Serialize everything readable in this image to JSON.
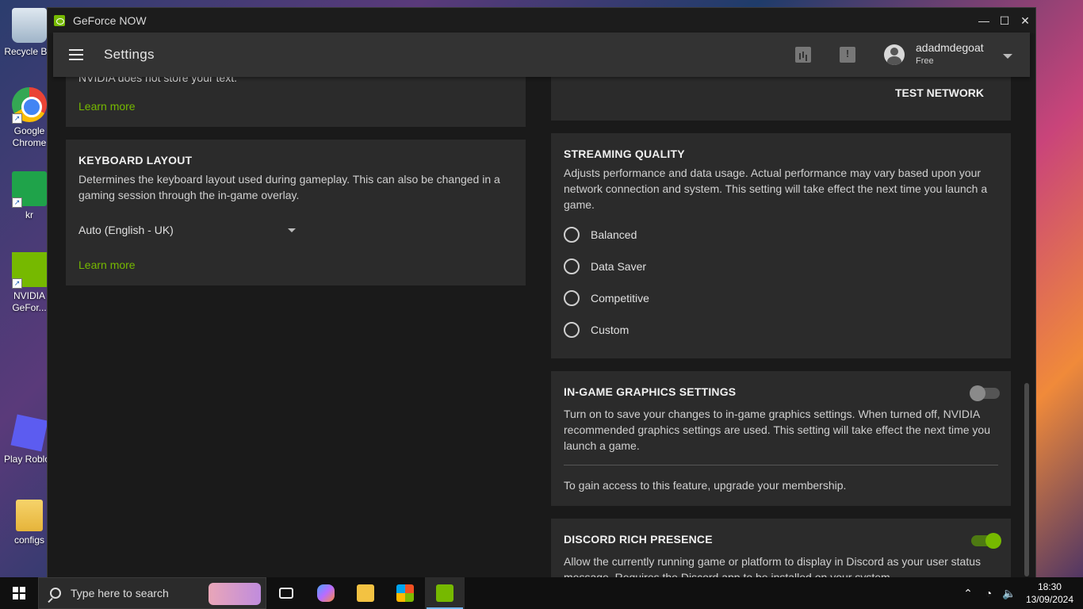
{
  "desktop": {
    "icons": [
      {
        "label": "Recycle Bin"
      },
      {
        "label": "Google Chrome"
      },
      {
        "label": "kr"
      },
      {
        "label": "NVIDIA GeFor..."
      },
      {
        "label": "Play Roblox"
      },
      {
        "label": "configs"
      }
    ]
  },
  "window": {
    "title": "GeForce NOW",
    "minimize": "—",
    "maximize": "☐",
    "close": "✕"
  },
  "appbar": {
    "title": "Settings",
    "user_name": "adadmdegoat",
    "user_tier": "Free"
  },
  "panels": {
    "prev_card": {
      "text": "NVIDIA does not store your text.",
      "link": "Learn more"
    },
    "keyboard": {
      "heading": "KEYBOARD LAYOUT",
      "description": "Determines the keyboard layout used during gameplay. This can also be changed in a gaming session through the in-game overlay.",
      "selected": "Auto (English - UK)",
      "link": "Learn more"
    },
    "network": {
      "test_button": "TEST NETWORK"
    },
    "streaming": {
      "heading": "STREAMING QUALITY",
      "description": "Adjusts performance and data usage. Actual performance may vary based upon your network connection and system. This setting will take effect the next time you launch a game.",
      "options": [
        "Balanced",
        "Data Saver",
        "Competitive",
        "Custom"
      ]
    },
    "graphics": {
      "heading": "IN-GAME GRAPHICS SETTINGS",
      "description": "Turn on to save your changes to in-game graphics settings. When turned off, NVIDIA recommended graphics settings are used. This setting will take effect the next time you launch a game.",
      "note": "To gain access to this feature, upgrade your membership.",
      "enabled": false
    },
    "discord": {
      "heading": "DISCORD RICH PRESENCE",
      "description": "Allow the currently running game or platform to display in Discord as your user status message. Requires the Discord app to be installed on your system.",
      "enabled": true
    }
  },
  "taskbar": {
    "search_placeholder": "Type here to search",
    "time": "18:30",
    "date": "13/09/2024"
  }
}
